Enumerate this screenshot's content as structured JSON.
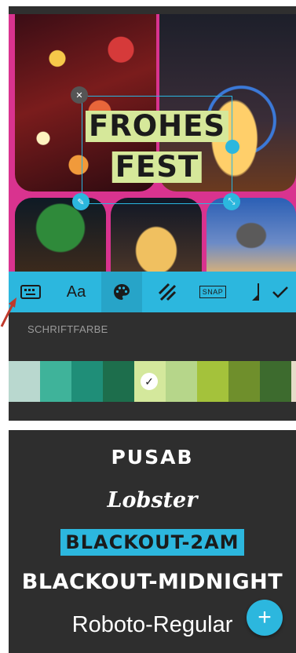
{
  "editor": {
    "canvas_text": {
      "line1": "FROHES",
      "line2": "FEST"
    },
    "handles": {
      "close": "✕",
      "edit": "✎",
      "scale": "⤡"
    },
    "toolbar": {
      "items": [
        {
          "icon": "keyboard-icon"
        },
        {
          "label": "Aa"
        },
        {
          "icon": "palette-icon",
          "active": true
        },
        {
          "icon": "stripes-icon"
        },
        {
          "label": "SNAP"
        },
        {
          "icon": "text-size-icon"
        },
        {
          "icon": "check-icon"
        }
      ]
    },
    "section_label": "SCHRIFTFARBE",
    "swatches": [
      "#b9d8cf",
      "#3fb39a",
      "#1f8e78",
      "#1d6e4c",
      "#d4e89c",
      "#b6d68a",
      "#a4c23b",
      "#6f8f2c",
      "#3d6b2e",
      "#e6dcc8"
    ],
    "selected_swatch_index": 4,
    "selected_mark": "✓"
  },
  "font_list": {
    "fonts": [
      "PUSAB",
      "Lobster",
      "BLACKOUT-2AM",
      "BLACKOUT-MIDNIGHT",
      "Roboto-Regular"
    ],
    "selected_index": 2,
    "fab_label": "+"
  },
  "colors": {
    "accent": "#2cb7de",
    "panel": "#2f2f2f",
    "text_box_fill": "#d6e89a"
  }
}
